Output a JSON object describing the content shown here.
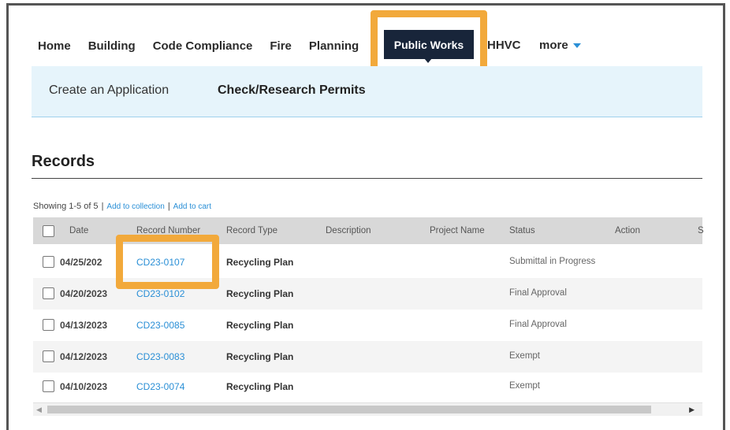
{
  "nav": {
    "items": [
      "Home",
      "Building",
      "Code Compliance",
      "Fire",
      "Planning"
    ],
    "active": "Public Works",
    "after": [
      "HHVC"
    ],
    "more": "more"
  },
  "subnav": {
    "create": "Create an Application",
    "check": "Check/Research Permits"
  },
  "records": {
    "title": "Records",
    "showing": "Showing 1-5 of 5",
    "add_collection": "Add to collection",
    "add_cart": "Add to cart",
    "columns": [
      "Date",
      "Record Number",
      "Record Type",
      "Description",
      "Project Name",
      "Status",
      "Action",
      "S"
    ],
    "rows": [
      {
        "date": "04/25/202",
        "number": "CD23-0107",
        "type": "Recycling Plan",
        "status": "Submittal in Progress"
      },
      {
        "date": "04/20/2023",
        "number": "CD23-0102",
        "type": "Recycling Plan",
        "status": "Final Approval"
      },
      {
        "date": "04/13/2023",
        "number": "CD23-0085",
        "type": "Recycling Plan",
        "status": "Final Approval"
      },
      {
        "date": "04/12/2023",
        "number": "CD23-0083",
        "type": "Recycling Plan",
        "status": "Exempt"
      },
      {
        "date": "04/10/2023",
        "number": "CD23-0074",
        "type": "Recycling Plan",
        "status": "Exempt"
      }
    ]
  },
  "colors": {
    "highlight": "#f2a93b",
    "active_tab": "#18253a",
    "link": "#2a8fd6",
    "subnav_bg": "#e6f4fb"
  }
}
